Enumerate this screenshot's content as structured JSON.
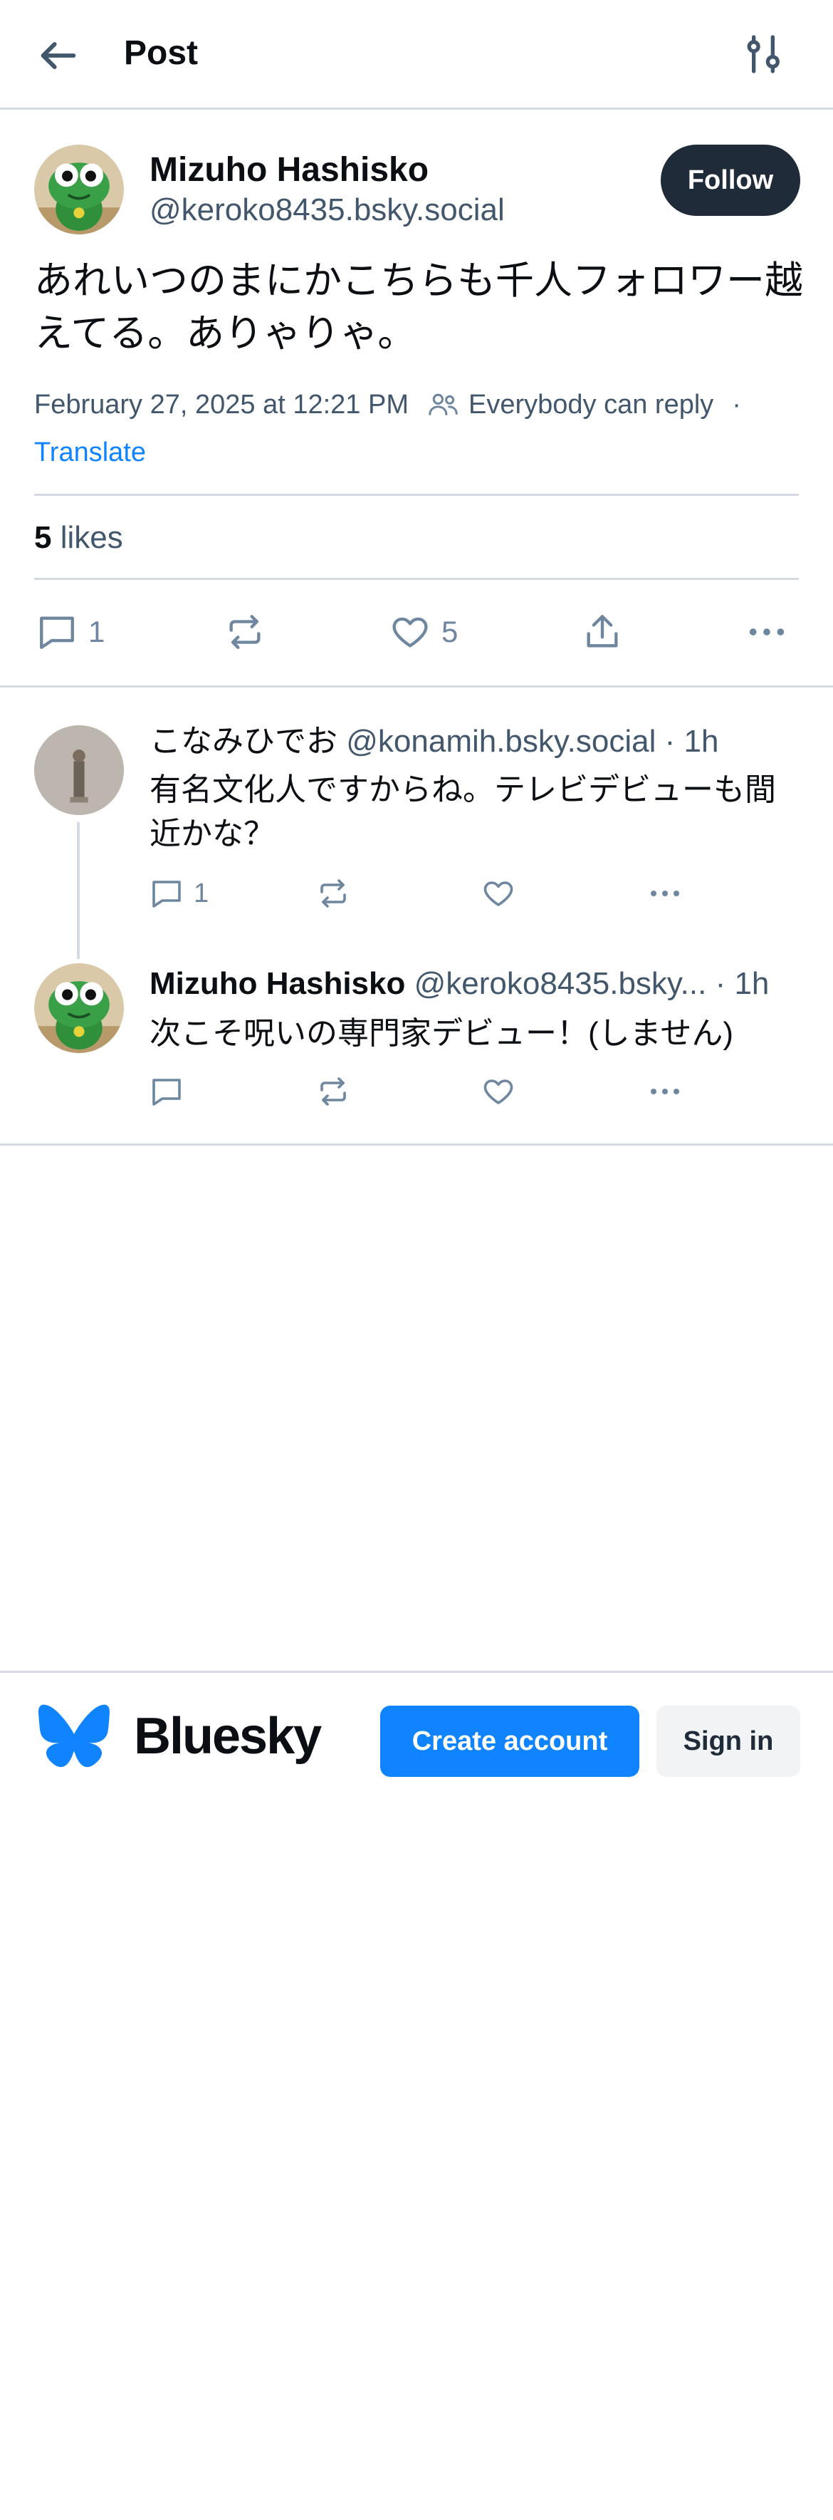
{
  "header": {
    "title": "Post",
    "back_icon": "arrow-left-icon",
    "settings_icon": "sliders-icon"
  },
  "post": {
    "author_name": "Mizuho Hashisko",
    "author_handle": "@keroko8435.bsky.social",
    "follow_label": "Follow",
    "text": "あれいつのまにかこちらも千人フォロワー越えてる。ありゃりゃ。",
    "timestamp": "February 27, 2025 at 12:21 PM",
    "reply_setting": "Everybody can reply",
    "separator": "·",
    "translate_label": "Translate",
    "likes_count": "5",
    "likes_label": "likes",
    "reply_count": "1",
    "like_count": "5"
  },
  "replies": [
    {
      "name": "こなみひでお",
      "handle": "@konamih.bsky.social",
      "time": "· 1h",
      "text": "有名文化人ですからね。テレビデビューも間近かな？",
      "reply_count": "1"
    },
    {
      "name": "Mizuho Hashisko",
      "handle": "@keroko8435.bsky...",
      "time": "· 1h",
      "text": "次こそ呪いの専門家デビュー！(しません)",
      "reply_count": ""
    }
  ],
  "footer": {
    "brand": "Bluesky",
    "create_account_label": "Create account",
    "sign_in_label": "Sign in"
  },
  "colors": {
    "accent": "#1083fe",
    "text_secondary": "#42576c",
    "icon": "#6f869f",
    "follow_bg": "#1f2b38"
  }
}
